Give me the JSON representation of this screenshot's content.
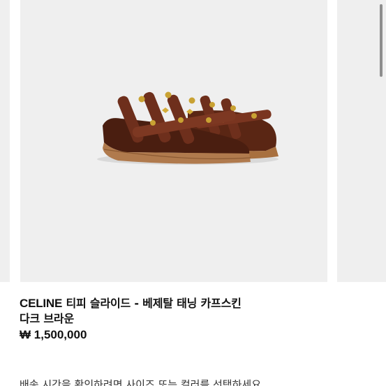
{
  "product": {
    "brand": "CELINE",
    "name_line1": "티피 슬라이드 - 베제탈 태닝 카프스킨",
    "name_line2": "다크 브라운",
    "price": "₩ 1,500,000",
    "image_icon": "sandal-product-image"
  },
  "notice": {
    "text": "배송 시간을 확인하려면 사이즈 또는 컬러를 선택하세요"
  },
  "colors": {
    "image_background": "#efefef",
    "sole": "#b07a4d",
    "strap": "#6e2f1c",
    "stud": "#c9a233",
    "text": "#111111"
  }
}
